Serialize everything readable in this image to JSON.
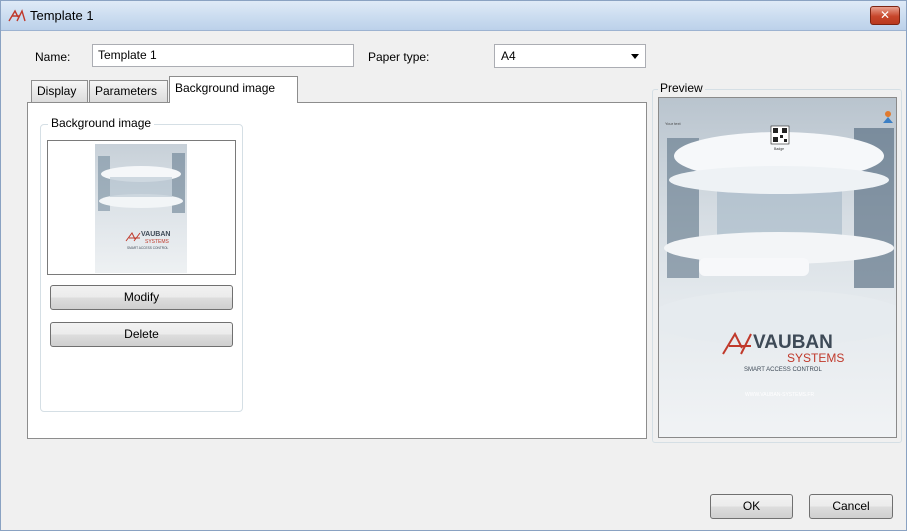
{
  "window": {
    "title": "Template 1"
  },
  "form": {
    "name_label": "Name:",
    "name_value": "Template 1",
    "paper_type_label": "Paper type:",
    "paper_type_value": "A4"
  },
  "tabs": [
    {
      "label": "Display",
      "active": false
    },
    {
      "label": "Parameters",
      "active": false
    },
    {
      "label": "Background image",
      "active": true
    }
  ],
  "background_group": {
    "legend": "Background image",
    "modify_label": "Modify",
    "delete_label": "Delete"
  },
  "preview": {
    "legend": "Preview",
    "brand_main": "VAUBAN",
    "brand_sub": "SYSTEMS",
    "tagline": "SMART ACCESS CONTROL",
    "website": "WWW.VAUBAN-SYSTEMS.FR",
    "small_text": "Your text",
    "qr_caption": "Badge"
  },
  "thumbnail": {
    "brand_main": "VAUBAN",
    "brand_sub": "SYSTEMS",
    "tagline": "SMART ACCESS CONTROL"
  },
  "footer": {
    "ok_label": "OK",
    "cancel_label": "Cancel"
  },
  "colors": {
    "brand_red": "#c0392b",
    "brand_gray": "#3e4a57",
    "accent_blue": "#3c7fc4"
  }
}
